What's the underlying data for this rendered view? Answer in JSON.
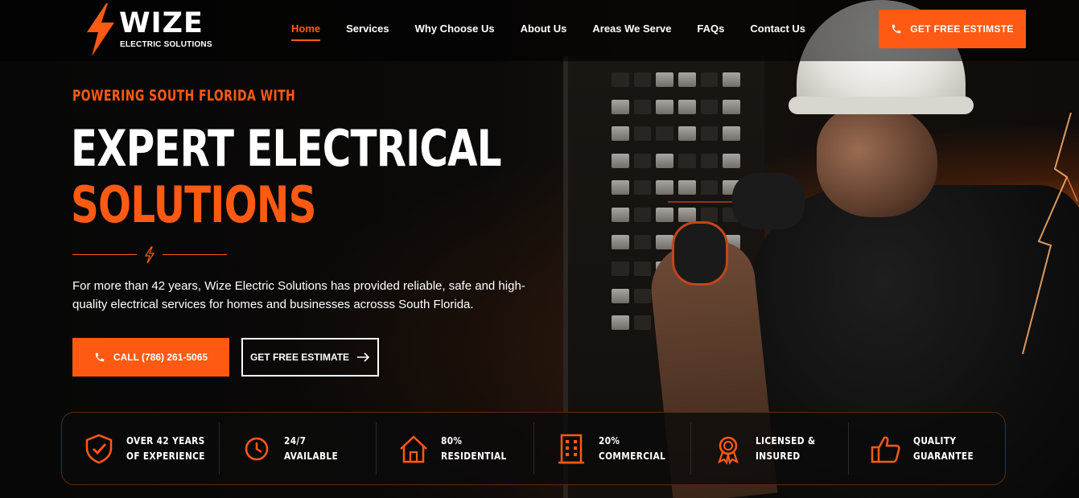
{
  "brand": {
    "name": "WIZE",
    "tagline": "ELECTRIC SOLUTIONS",
    "accent_color": "#ff5a14"
  },
  "nav": {
    "items": [
      {
        "label": "Home",
        "active": true
      },
      {
        "label": "Services",
        "active": false
      },
      {
        "label": "Why Choose Us",
        "active": false
      },
      {
        "label": "About Us",
        "active": false
      },
      {
        "label": "Areas We Serve",
        "active": false
      },
      {
        "label": "FAQs",
        "active": false
      },
      {
        "label": "Contact Us",
        "active": false
      }
    ],
    "cta_label": "GET FREE ESTIMSTE",
    "cta_icon": "phone-icon"
  },
  "hero": {
    "eyebrow": "POWERING SOUTH FLORIDA WITH",
    "headline_line1": "EXPERT ELECTRICAL",
    "headline_line2": "SOLUTIONS",
    "description": "For more than 42 years, Wize Electric Solutions has provided reliable, safe and high-quality electrical services for homes and businesses acrosss South Florida.",
    "call_button": "CALL (786) 261-5065",
    "estimate_button": "GET FREE ESTIMATE"
  },
  "stats": [
    {
      "line1": "OVER 42 YEARS",
      "line2": "OF EXPERIENCE",
      "icon": "shield-check-icon"
    },
    {
      "line1": "24/7",
      "line2": "AVAILABLE",
      "icon": "clock-icon"
    },
    {
      "line1": "80%",
      "line2": "RESIDENTIAL",
      "icon": "house-icon"
    },
    {
      "line1": "20%",
      "line2": "COMMERCIAL",
      "icon": "building-icon"
    },
    {
      "line1": "LICENSED &",
      "line2": "INSURED",
      "icon": "award-badge-icon"
    },
    {
      "line1": "QUALITY",
      "line2": "GUARANTEE",
      "icon": "thumbs-up-icon"
    }
  ]
}
